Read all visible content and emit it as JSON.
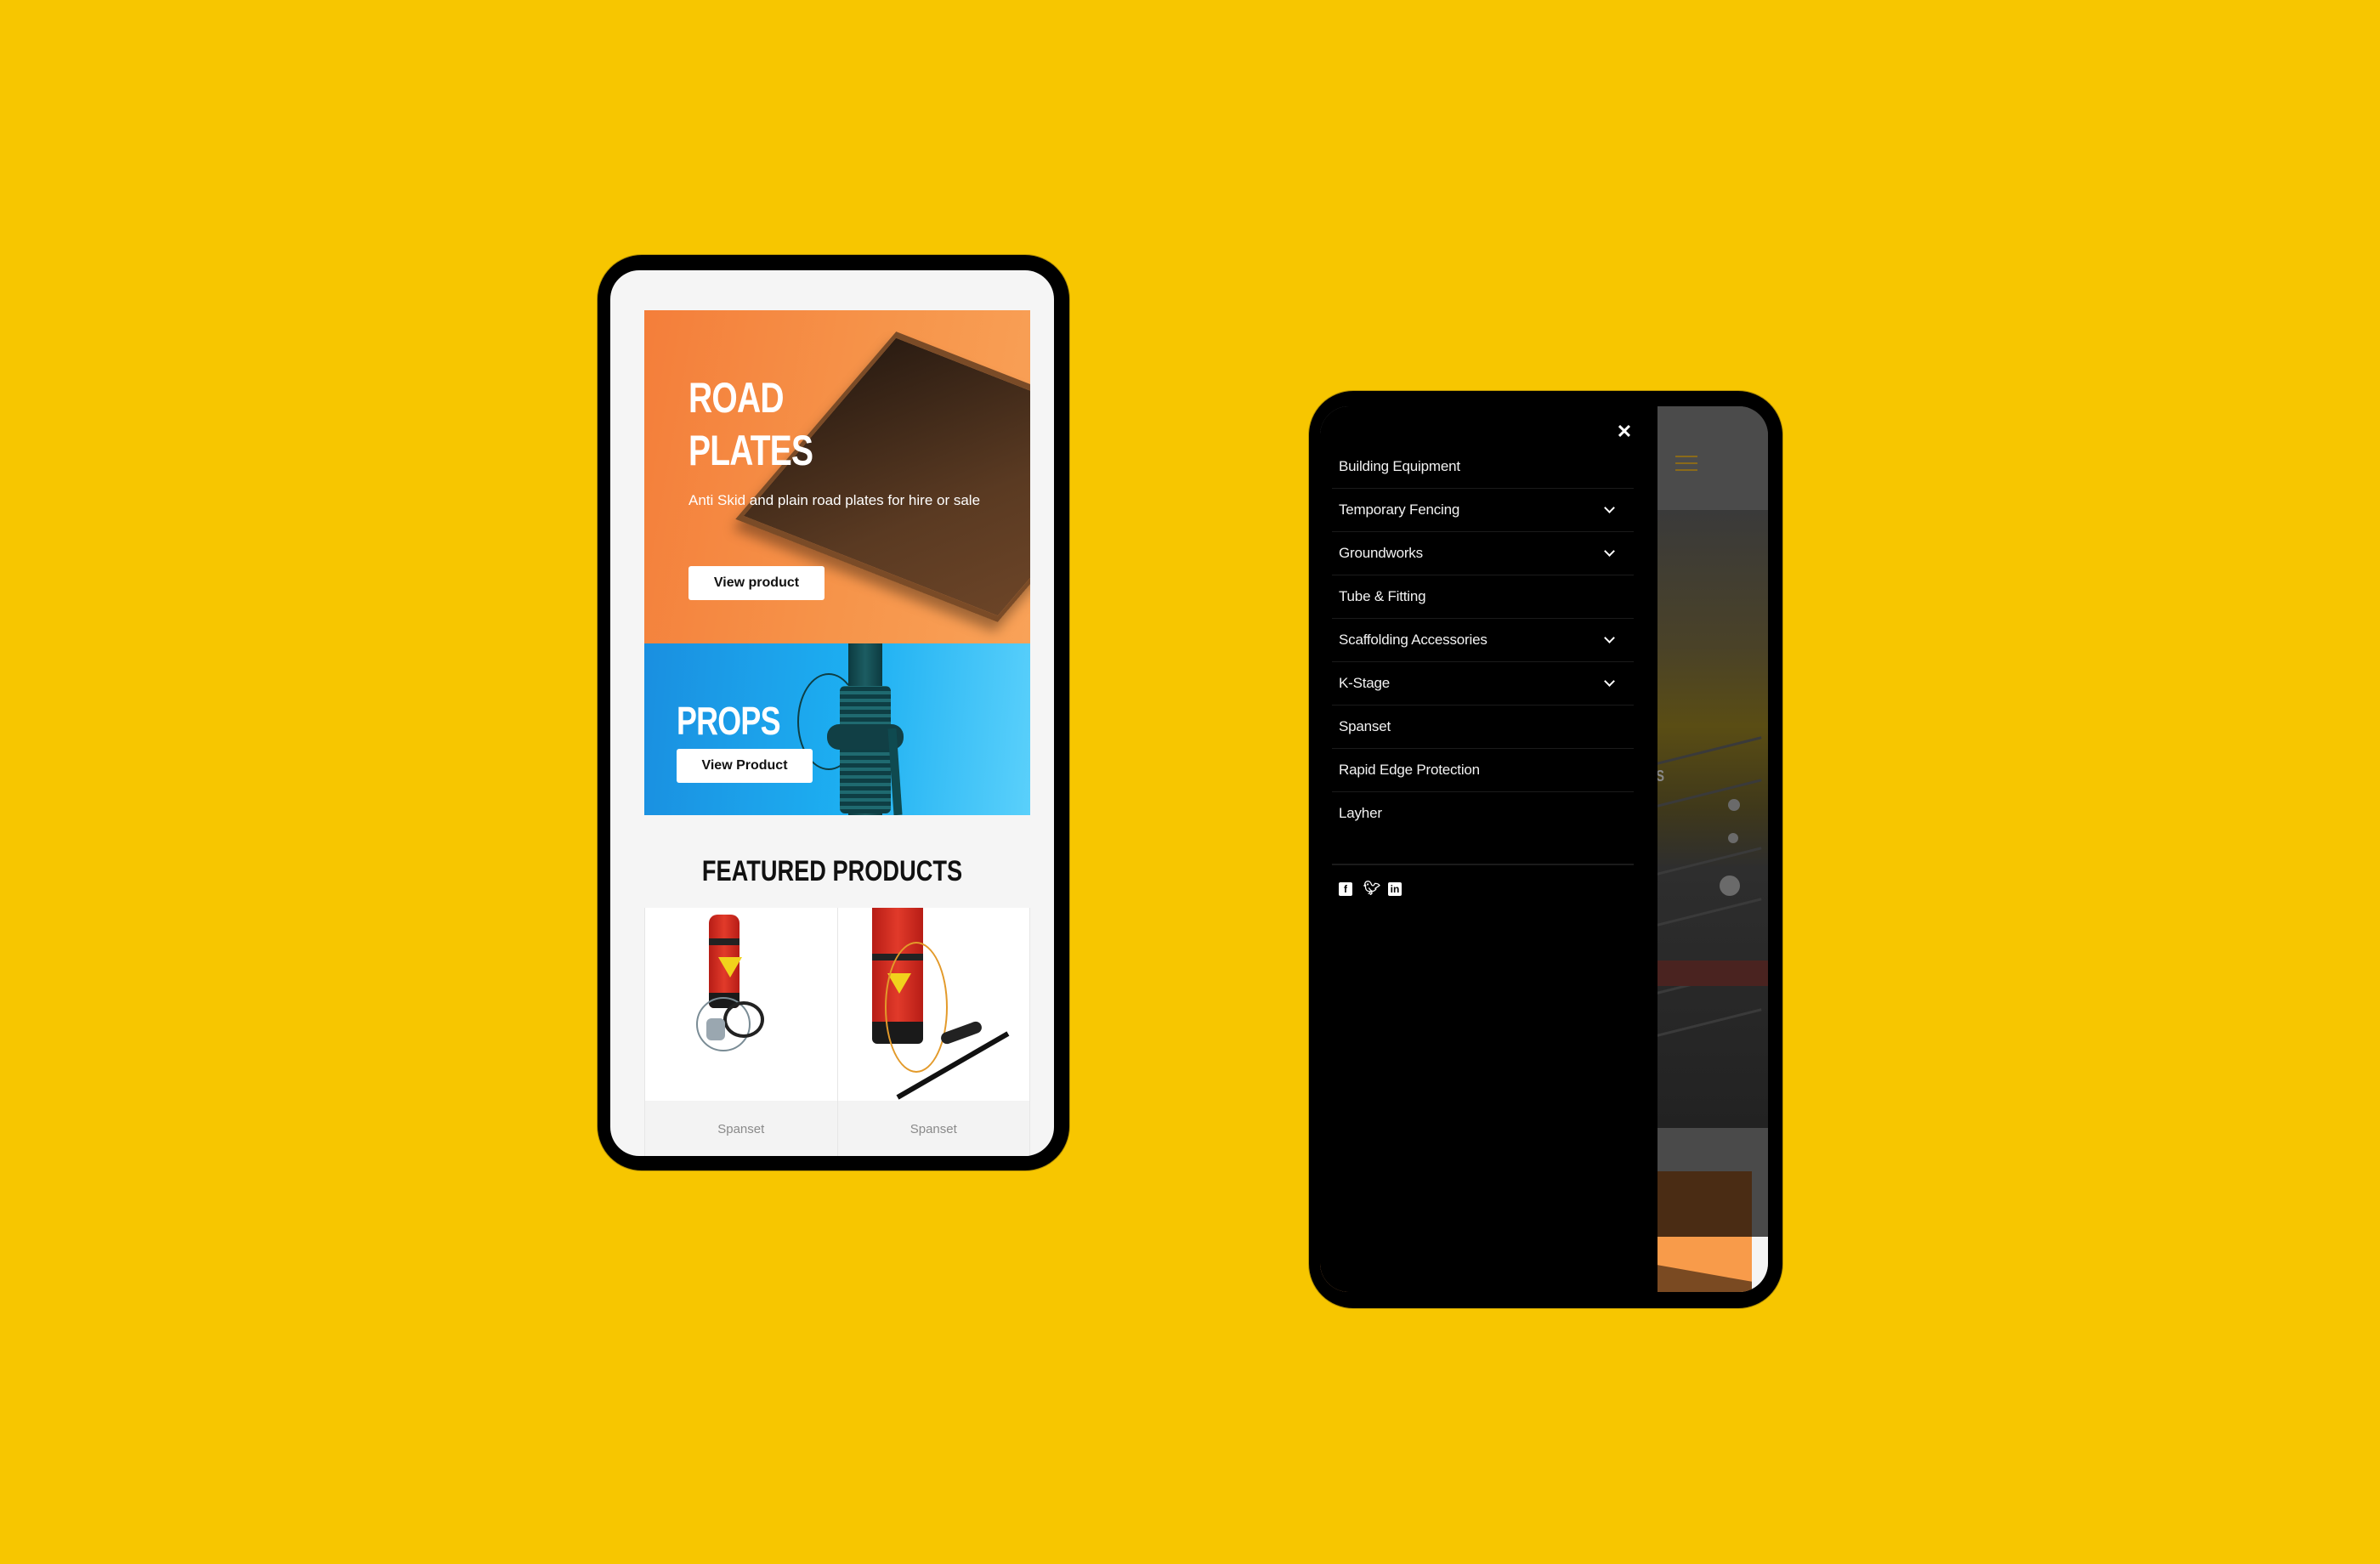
{
  "background_color": "#f7c600",
  "left_phone": {
    "hero_road_plates": {
      "title_line1": "ROAD",
      "title_line2": "PLATES",
      "description": "Anti Skid and plain road plates for hire or sale",
      "button_label": "View product",
      "color": "#f6904a"
    },
    "hero_props": {
      "title": "PROPS",
      "button_label": "View Product",
      "color": "#1db0f2"
    },
    "featured": {
      "title": "FEATURED PRODUCTS",
      "products": [
        {
          "label": "Spanset",
          "image": "red rescue bag with winch"
        },
        {
          "label": "Spanset",
          "image": "red rescue bag with pole and rope"
        }
      ]
    }
  },
  "right_phone": {
    "drawer": {
      "close_icon": "close-icon",
      "menu_items": [
        {
          "label": "Building Equipment",
          "has_submenu": false
        },
        {
          "label": "Temporary Fencing",
          "has_submenu": true
        },
        {
          "label": "Groundworks",
          "has_submenu": true
        },
        {
          "label": "Tube & Fitting",
          "has_submenu": false
        },
        {
          "label": "Scaffolding Accessories",
          "has_submenu": true
        },
        {
          "label": "K-Stage",
          "has_submenu": true
        },
        {
          "label": "Spanset",
          "has_submenu": false
        },
        {
          "label": "Rapid Edge Protection",
          "has_submenu": false
        },
        {
          "label": "Layher",
          "has_submenu": false
        }
      ],
      "social": [
        {
          "name": "facebook",
          "glyph": "f"
        },
        {
          "name": "twitter",
          "glyph": "🐦"
        },
        {
          "name": "linkedin",
          "glyph": "in"
        }
      ]
    },
    "background_page": {
      "menu_icon": "hamburger-icon",
      "hero_text_fragment": "TOWERS"
    }
  }
}
